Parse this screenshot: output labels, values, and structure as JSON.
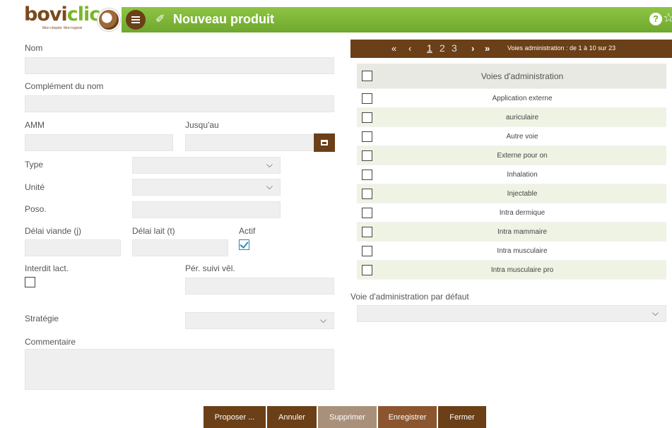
{
  "header": {
    "logo_part1": "bovi",
    "logo_part2": "clic",
    "logo_tagline": "Mon cheptel. Mon logiciel",
    "title": "Nouveau produit",
    "help_symbol": "?",
    "star_symbol": "☆"
  },
  "form": {
    "nom_label": "Nom",
    "nom_value": "",
    "complement_label": "Complément du nom",
    "complement_value": "",
    "amm_label": "AMM",
    "amm_value": "",
    "jusquau_label": "Jusqu'au",
    "jusquau_value": "",
    "type_label": "Type",
    "type_value": "",
    "unite_label": "Unité",
    "unite_value": "",
    "poso_label": "Poso.",
    "poso_value": "",
    "delai_viande_label": "Délai viande (j)",
    "delai_viande_value": "",
    "delai_lait_label": "Délai lait (t)",
    "delai_lait_value": "",
    "actif_label": "Actif",
    "actif_checked": true,
    "interdit_lact_label": "Interdit lact.",
    "interdit_lact_checked": false,
    "per_suivi_label": "Pér. suivi vêl.",
    "per_suivi_value": "",
    "strategie_label": "Stratégie",
    "strategie_value": "",
    "commentaire_label": "Commentaire",
    "commentaire_value": ""
  },
  "pager": {
    "first": "«",
    "prev": "‹",
    "pages": [
      "1",
      "2",
      "3"
    ],
    "current_page": "1",
    "next": "›",
    "last": "»",
    "info": "Voies administration : de 1 à 10 sur 23"
  },
  "grid": {
    "header": "Voies d'administration",
    "rows": [
      "Application externe",
      "auriculaire",
      "Autre voie",
      "Externe pour on",
      "Inhalation",
      "Injectable",
      "Intra dermique",
      "Intra mammaire",
      "Intra musculaire",
      "Intra musculaire pro"
    ]
  },
  "voie_defaut": {
    "label": "Voie d'administration par défaut",
    "value": ""
  },
  "footer": {
    "proposer": "Proposer ...",
    "annuler": "Annuler",
    "supprimer": "Supprimer",
    "enregistrer": "Enregistrer",
    "fermer": "Fermer"
  },
  "colors": {
    "brand_green": "#7ab52f",
    "brand_brown": "#6b3f17",
    "row_alt": "#eef3e4"
  }
}
